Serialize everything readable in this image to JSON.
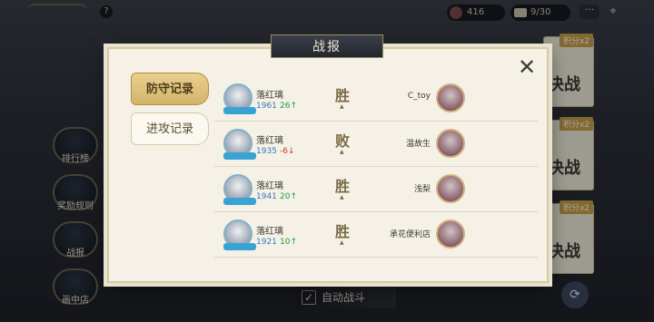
{
  "topbar": {
    "help_icon": "?",
    "stamina_value": "416",
    "tickets_value": "9/30",
    "menu_icon": "···",
    "pin_icon": "⌖"
  },
  "side_nav": {
    "items": [
      {
        "label": "排行榜"
      },
      {
        "label": "奖励规则"
      },
      {
        "label": "战报"
      },
      {
        "label": "画中店"
      }
    ]
  },
  "right_cards": [
    {
      "badge": "积分x2",
      "label": "决战"
    },
    {
      "badge": "积分x2",
      "label": "决战"
    },
    {
      "badge": "积分x2",
      "label": "决战"
    }
  ],
  "bottom": {
    "auto_battle_label": "自动战斗",
    "auto_battle_checked": "✓",
    "refresh_icon": "⟳"
  },
  "modal": {
    "title": "战报",
    "close_icon": "✕",
    "tabs": [
      {
        "label": "防守记录",
        "active": true
      },
      {
        "label": "进攻记录",
        "active": false
      }
    ],
    "rows": [
      {
        "player_name": "落红璃",
        "player_score": "1961",
        "delta": "26↑",
        "delta_dir": "up",
        "result": "胜",
        "opponent": "C_toy"
      },
      {
        "player_name": "落红璃",
        "player_score": "1935",
        "delta": "-6↓",
        "delta_dir": "down",
        "result": "败",
        "opponent": "温故生"
      },
      {
        "player_name": "落红璃",
        "player_score": "1941",
        "delta": "20↑",
        "delta_dir": "up",
        "result": "胜",
        "opponent": "浅梨"
      },
      {
        "player_name": "落红璃",
        "player_score": "1921",
        "delta": "10↑",
        "delta_dir": "up",
        "result": "胜",
        "opponent": "承花便利店"
      }
    ]
  },
  "colors": {
    "up": "#1f9b4a",
    "down": "#c23b2f",
    "score": "#2f78c5",
    "accent_gold": "#c9a24a"
  }
}
